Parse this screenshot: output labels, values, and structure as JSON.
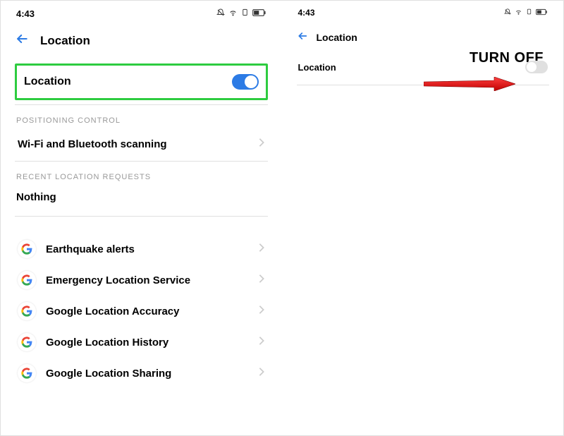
{
  "left": {
    "time": "4:43",
    "header": "Location",
    "main_toggle_label": "Location",
    "section_positioning": "POSITIONING CONTROL",
    "wifi_bt": "Wi-Fi and Bluetooth scanning",
    "section_recent": "RECENT LOCATION REQUESTS",
    "nothing": "Nothing",
    "items": [
      "Earthquake alerts",
      "Emergency Location Service",
      "Google Location Accuracy",
      "Google Location History",
      "Google Location Sharing"
    ]
  },
  "right": {
    "time": "4:43",
    "header": "Location",
    "main_toggle_label": "Location",
    "annotation": "TURN OFF"
  }
}
